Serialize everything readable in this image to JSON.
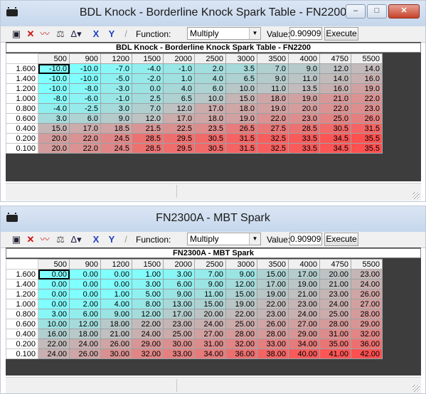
{
  "colors": {
    "min": "#80ffff",
    "mid": "#c0c0c0",
    "max": "#ff5050"
  },
  "toolbar": {
    "function_label": "Function:",
    "function_value": "Multiply",
    "value_label": "Value:",
    "value": "0.90909",
    "execute_label": "Execute"
  },
  "windows": [
    {
      "title": "BDL Knock - Borderline Knock Spark Table - FN2200",
      "grid_title": "BDL Knock - Borderline Knock Spark Table - FN2200",
      "cols": [
        "500",
        "900",
        "1200",
        "1500",
        "2000",
        "2500",
        "3000",
        "3500",
        "4000",
        "4750",
        "5500"
      ],
      "rows": [
        "1.600",
        "1.400",
        "1.200",
        "1.000",
        "0.800",
        "0.600",
        "0.400",
        "0.200",
        "0.100"
      ],
      "cells": [
        [
          "-10.0",
          "-10.0",
          "-7.0",
          "-4.0",
          "-1.0",
          "2.0",
          "3.5",
          "7.0",
          "9.0",
          "12.0",
          "14.0"
        ],
        [
          "-10.0",
          "-10.0",
          "-5.0",
          "-2.0",
          "1.0",
          "4.0",
          "6.5",
          "9.0",
          "11.0",
          "14.0",
          "16.0"
        ],
        [
          "-10.0",
          "-8.0",
          "-3.0",
          "0.0",
          "4.0",
          "6.0",
          "10.0",
          "11.0",
          "13.5",
          "16.0",
          "19.0"
        ],
        [
          "-8.0",
          "-6.0",
          "-1.0",
          "2.5",
          "6.5",
          "10.0",
          "15.0",
          "18.0",
          "19.0",
          "21.0",
          "22.0"
        ],
        [
          "-4.0",
          "-2.5",
          "3.0",
          "7.0",
          "12.0",
          "17.0",
          "18.0",
          "19.0",
          "20.0",
          "22.0",
          "23.0"
        ],
        [
          "3.0",
          "6.0",
          "9.0",
          "12.0",
          "17.0",
          "18.0",
          "19.0",
          "22.0",
          "23.0",
          "25.0",
          "26.0"
        ],
        [
          "15.0",
          "17.0",
          "18.5",
          "21.5",
          "22.5",
          "23.5",
          "26.5",
          "27.5",
          "28.5",
          "30.5",
          "31.5"
        ],
        [
          "20.0",
          "22.0",
          "24.5",
          "28.5",
          "29.5",
          "30.5",
          "31.5",
          "32.5",
          "33.5",
          "34.5",
          "35.5"
        ],
        [
          "20.0",
          "22.0",
          "24.5",
          "28.5",
          "29.5",
          "30.5",
          "31.5",
          "32.5",
          "33.5",
          "34.5",
          "35.5"
        ]
      ],
      "scale": [
        -10,
        35.5
      ]
    },
    {
      "title": "FN2300A - MBT Spark",
      "grid_title": "FN2300A - MBT Spark",
      "cols": [
        "500",
        "900",
        "1200",
        "1500",
        "2000",
        "2500",
        "3000",
        "3500",
        "4000",
        "4750",
        "5500"
      ],
      "rows": [
        "1.600",
        "1.400",
        "1.200",
        "1.000",
        "0.800",
        "0.600",
        "0.400",
        "0.200",
        "0.100"
      ],
      "cells": [
        [
          "0.00",
          "0.00",
          "0.00",
          "1.00",
          "3.00",
          "7.00",
          "9.00",
          "15.00",
          "17.00",
          "20.00",
          "23.00"
        ],
        [
          "0.00",
          "0.00",
          "0.00",
          "3.00",
          "6.00",
          "9.00",
          "12.00",
          "17.00",
          "19.00",
          "21.00",
          "24.00"
        ],
        [
          "0.00",
          "0.00",
          "1.00",
          "5.00",
          "9.00",
          "11.00",
          "15.00",
          "19.00",
          "21.00",
          "23.00",
          "26.00"
        ],
        [
          "0.00",
          "2.00",
          "4.00",
          "8.00",
          "13.00",
          "15.00",
          "19.00",
          "22.00",
          "23.00",
          "24.00",
          "27.00"
        ],
        [
          "3.00",
          "6.00",
          "9.00",
          "12.00",
          "17.00",
          "20.00",
          "22.00",
          "23.00",
          "24.00",
          "25.00",
          "28.00"
        ],
        [
          "10.00",
          "12.00",
          "18.00",
          "22.00",
          "23.00",
          "24.00",
          "25.00",
          "26.00",
          "27.00",
          "28.00",
          "29.00"
        ],
        [
          "16.00",
          "18.00",
          "21.00",
          "24.00",
          "25.00",
          "27.00",
          "28.00",
          "28.00",
          "29.00",
          "31.00",
          "32.00"
        ],
        [
          "22.00",
          "24.00",
          "26.00",
          "29.00",
          "30.00",
          "31.00",
          "32.00",
          "33.00",
          "34.00",
          "35.00",
          "36.00"
        ],
        [
          "24.00",
          "26.00",
          "30.00",
          "32.00",
          "33.00",
          "34.00",
          "36.00",
          "38.00",
          "40.00",
          "41.00",
          "42.00"
        ]
      ],
      "scale": [
        0,
        42
      ]
    }
  ]
}
